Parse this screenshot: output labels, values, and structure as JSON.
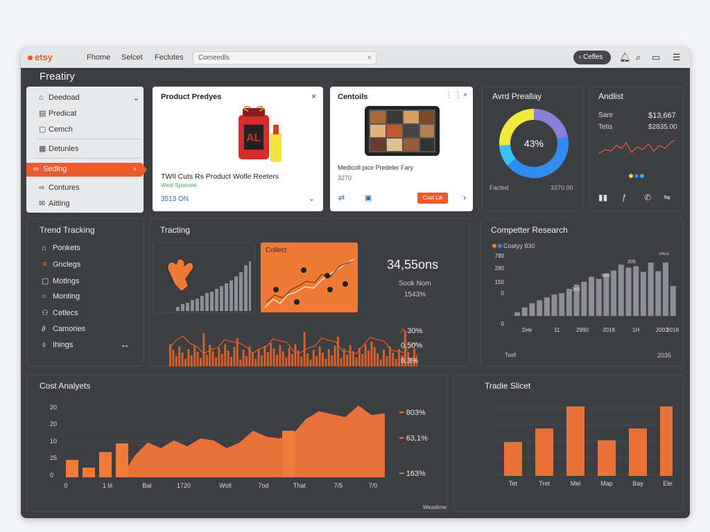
{
  "topbar": {
    "logo": "etsy",
    "nav": [
      "Fhome",
      "Selcet",
      "Feclutes"
    ],
    "search_placeholder": "Comeedls",
    "pill_label": "Cefles"
  },
  "page_title": "Freatiry",
  "sidebar": {
    "items": [
      {
        "label": "Deedoad",
        "icon": "lock-icon"
      },
      {
        "label": "Predicat",
        "icon": "file-icon"
      },
      {
        "label": "Cemch",
        "icon": "square-icon"
      },
      {
        "label": "Detunles",
        "icon": "grid-icon"
      },
      {
        "label": "Sedlng",
        "icon": "link-icon"
      },
      {
        "label": "Contures",
        "icon": "link-icon"
      },
      {
        "label": "Aitting",
        "icon": "mail-icon"
      }
    ]
  },
  "product_card": {
    "title": "Product Predyes",
    "headline": "TWIl Cuts Rs Product Wofle Reeters",
    "subline": "Weal Sponsee",
    "price": "3513 ON"
  },
  "contoils_card": {
    "title": "Centoils",
    "caption": "Medicoll pice Predeler Fary",
    "price": "3270",
    "button": "Cost Lik"
  },
  "donut": {
    "title": "Avrd Preallay",
    "center": "43%",
    "left_label": "Facted",
    "right_label": "3370.00",
    "segments": [
      {
        "value": 22,
        "color": "#8b7fd8"
      },
      {
        "value": 42,
        "color": "#2f8df0"
      },
      {
        "value": 10,
        "color": "#36c3f0"
      },
      {
        "value": 26,
        "color": "#f3ea3a"
      }
    ]
  },
  "analist": {
    "title": "Andlist",
    "row1_label": "Sare",
    "row1_value": "$13,667",
    "row2_label": "Tetis",
    "row2_value": "$2835.00"
  },
  "trend_tracking": {
    "title": "Trend Tracking",
    "items": [
      {
        "label": "Ponkets",
        "icon": "lock-icon"
      },
      {
        "label": "Gnclegs",
        "icon": "x-icon"
      },
      {
        "label": "Motlngs",
        "icon": "folder-icon"
      },
      {
        "label": "Monting",
        "icon": "circle-icon"
      },
      {
        "label": "Cetlecs",
        "icon": "users-icon"
      },
      {
        "label": "Camories",
        "icon": "link-icon"
      },
      {
        "label": "Ihings",
        "icon": "info-icon"
      }
    ]
  },
  "tracking": {
    "title": "Tracting",
    "collect_label": "Collect",
    "kpi_value": "34,55ons",
    "kpi_label": "Sook Nom",
    "kpi_sub": "1543%",
    "pct1": "30%",
    "pct2": "0,50%",
    "pct3": "6,3%"
  },
  "competitor": {
    "title": "Competter Research",
    "legend": "Coatyy 830",
    "footer_left": "Tsalt",
    "footer_right": "2035"
  },
  "cost": {
    "title": "Cost Analyets",
    "pct1": "803%",
    "pct2": "63,1%",
    "pct3": "163%",
    "footer": "Weadime"
  },
  "trade": {
    "title": "Tradie Slicet"
  },
  "chart_data": [
    {
      "type": "bar",
      "title": "Competter Research",
      "categories": [
        "2ele",
        "11",
        "2990",
        "2018",
        "1H",
        "2003",
        "2018"
      ],
      "y_ticks": [
        "790",
        "280",
        "150",
        "0",
        "0"
      ],
      "top_labels": [
        "2922",
        "205",
        "860",
        "285"
      ],
      "values": [
        5,
        12,
        18,
        22,
        26,
        30,
        32,
        38,
        44,
        48,
        55,
        52,
        60,
        64,
        72,
        68,
        70,
        62,
        75,
        63,
        75,
        42
      ]
    },
    {
      "type": "bar",
      "title": "Tradie Slicet",
      "categories": [
        "Tet",
        "Tret",
        "Mel",
        "Map",
        "Bay",
        "Eley"
      ],
      "values": [
        40,
        56,
        82,
        42,
        56,
        82
      ]
    },
    {
      "type": "area",
      "title": "Cost Analyets",
      "x_ticks": [
        "0",
        "1 til",
        "Bal",
        "1720",
        "Wolt",
        "7od",
        "That",
        "7/5",
        "7/0"
      ],
      "y_ticks": [
        "20",
        "20",
        "10",
        "25",
        "0"
      ],
      "bars": [
        18,
        10,
        26,
        35,
        0,
        0,
        0,
        0,
        0,
        0,
        0,
        0,
        0,
        48
      ],
      "area": [
        0,
        0,
        0,
        0,
        22,
        36,
        30,
        38,
        32,
        40,
        38,
        30,
        36,
        48,
        42,
        40,
        44,
        60,
        68,
        65,
        62,
        74,
        64,
        66
      ]
    }
  ]
}
